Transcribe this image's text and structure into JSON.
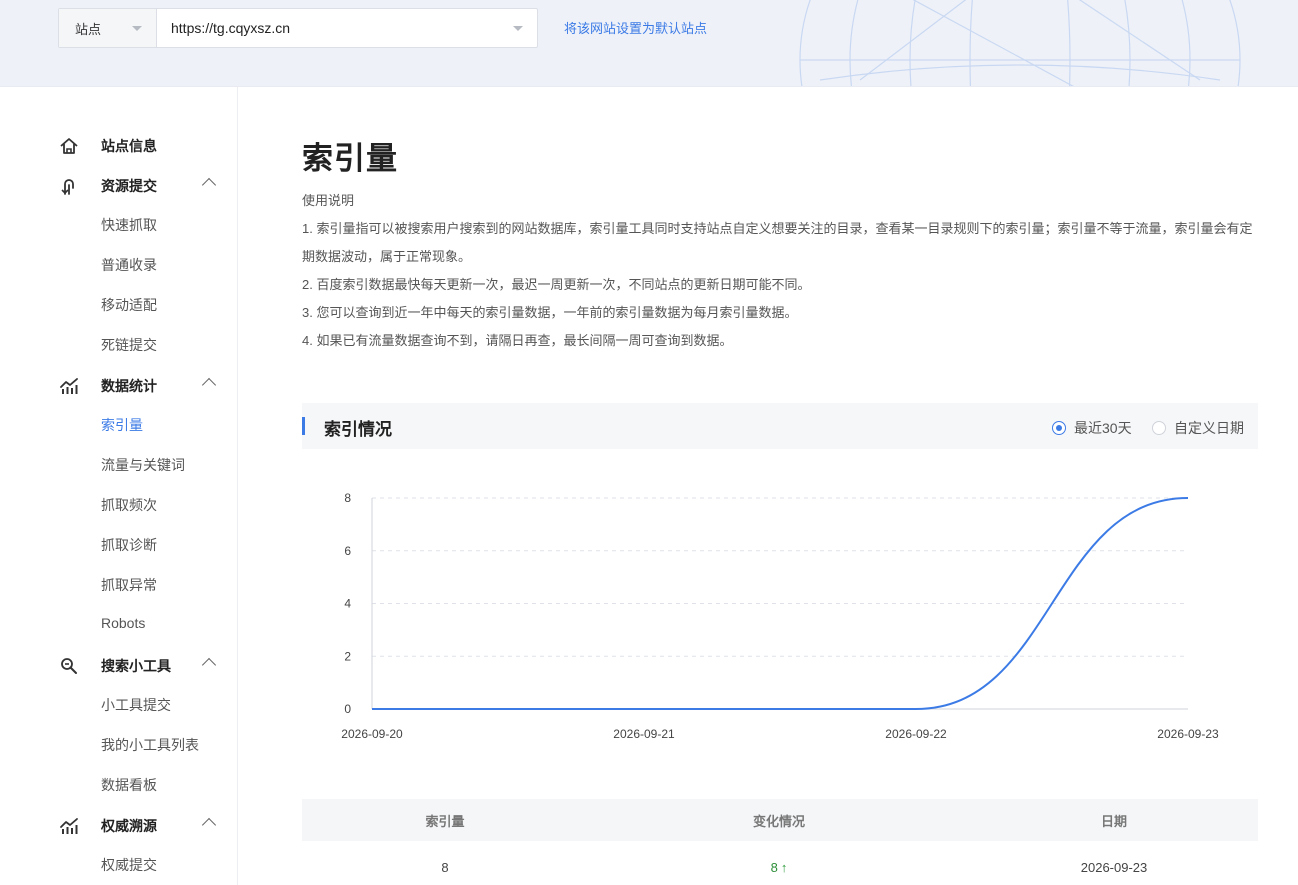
{
  "header": {
    "site_label": "站点",
    "site_url": "https://tg.cqyxsz.cn",
    "default_link": "将该网站设置为默认站点"
  },
  "sidebar": {
    "groups": [
      {
        "label": "站点信息",
        "icon": "home-icon"
      },
      {
        "label": "资源提交",
        "icon": "submit-icon",
        "items": [
          "快速抓取",
          "普通收录",
          "移动适配",
          "死链提交"
        ]
      },
      {
        "label": "数据统计",
        "icon": "stats-icon",
        "items": [
          "索引量",
          "流量与关键词",
          "抓取频次",
          "抓取诊断",
          "抓取异常",
          "Robots"
        ]
      },
      {
        "label": "搜索小工具",
        "icon": "tool-icon",
        "items": [
          "小工具提交",
          "我的小工具列表",
          "数据看板"
        ]
      },
      {
        "label": "权威溯源",
        "icon": "authority-icon",
        "items": [
          "权威提交"
        ]
      }
    ],
    "active_item": "索引量"
  },
  "main": {
    "title": "索引量",
    "usage_title": "使用说明",
    "usage": [
      "1. 索引量指可以被搜索用户搜索到的网站数据库，索引量工具同时支持站点自定义想要关注的目录，查看某一目录规则下的索引量；索引量不等于流量，索引量会有定期数据波动，属于正常现象。",
      "2. 百度索引数据最快每天更新一次，最迟一周更新一次，不同站点的更新日期可能不同。",
      "3. 您可以查询到近一年中每天的索引量数据，一年前的索引量数据为每月索引量数据。",
      "4. 如果已有流量数据查询不到，请隔日再查，最长间隔一周可查询到数据。"
    ],
    "section_title": "索引情况",
    "radio_recent": "最近30天",
    "radio_custom": "自定义日期"
  },
  "chart_data": {
    "type": "line",
    "x": [
      "2026-09-20",
      "2026-09-21",
      "2026-09-22",
      "2026-09-23"
    ],
    "series": [
      {
        "values": [
          0,
          0,
          0,
          8
        ]
      }
    ],
    "ylim": [
      0,
      8
    ],
    "yticks": [
      0,
      2,
      4,
      6,
      8
    ],
    "grid": true,
    "line_color": "#3c7be6"
  },
  "table": {
    "headers": [
      "索引量",
      "变化情况",
      "日期"
    ],
    "rows": [
      {
        "index": "8",
        "change": "8",
        "date": "2026-09-23"
      }
    ]
  },
  "colors": {
    "accent": "#3c7be6",
    "up": "#2f9d3d"
  }
}
